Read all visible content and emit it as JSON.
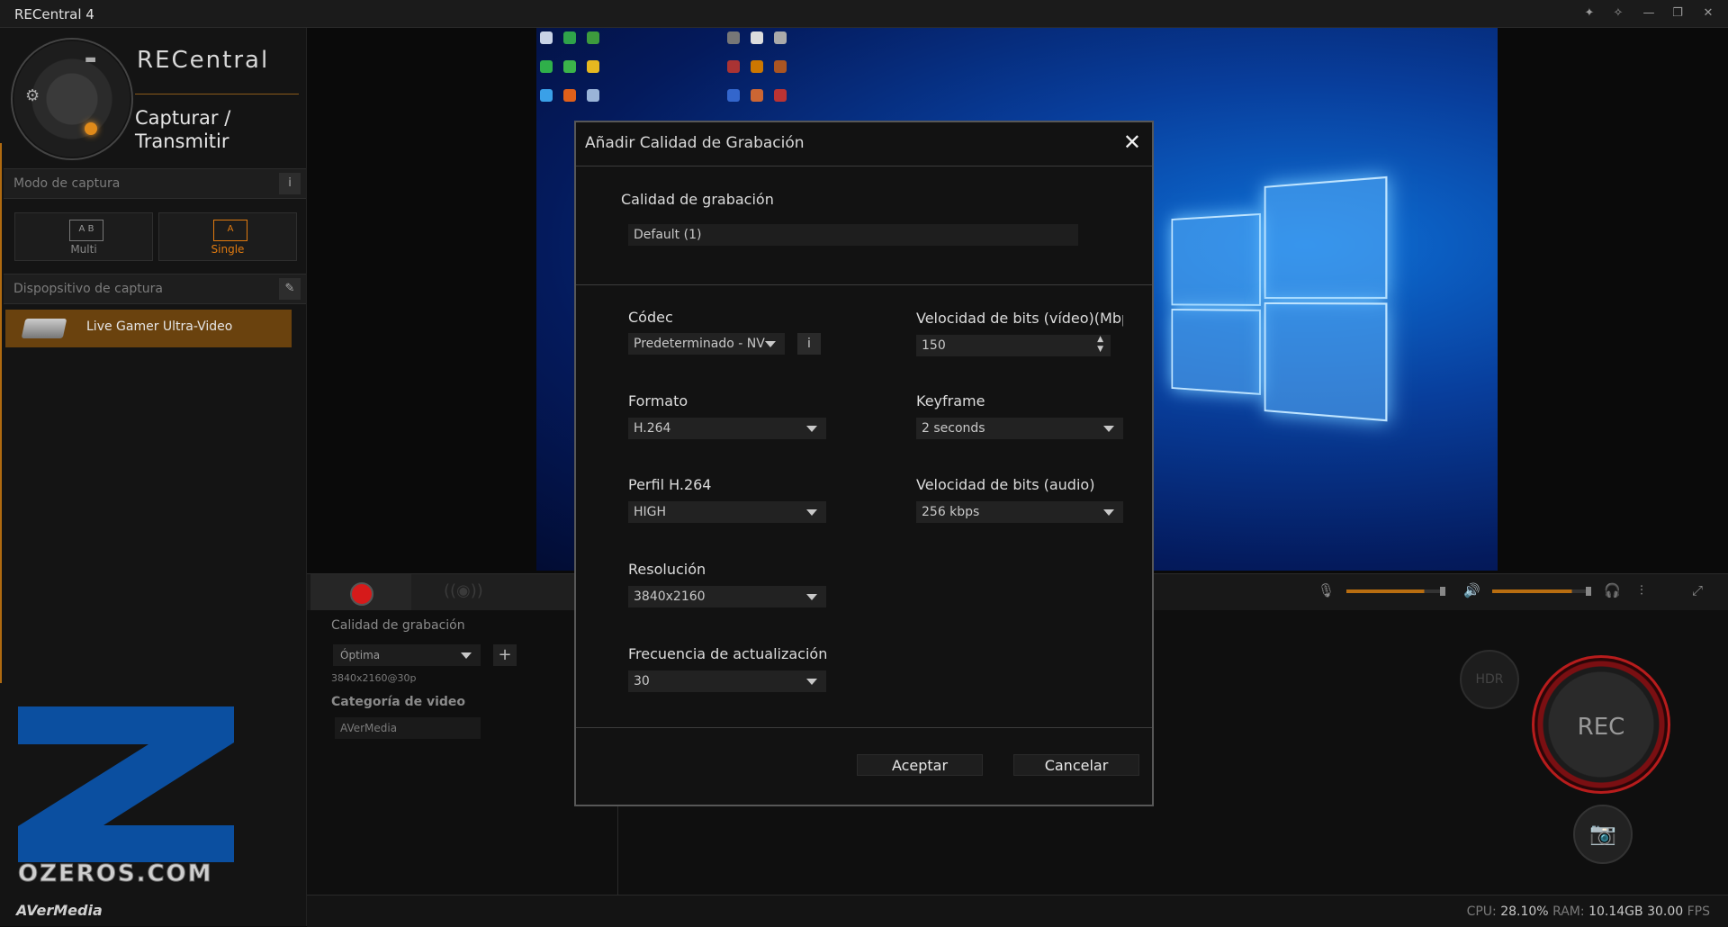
{
  "window": {
    "title": "RECentral 4",
    "controls": [
      "pin-icon",
      "pin-alt-icon",
      "minimize-icon",
      "restore-icon",
      "close-icon"
    ]
  },
  "sidebar": {
    "brand": "RECentral",
    "mode_title": "Capturar / Transmitir",
    "capture_mode": {
      "label": "Modo de captura",
      "info_icon": "i",
      "options": [
        {
          "box": "A  B",
          "label": "Multi"
        },
        {
          "box": "A",
          "label": "Single"
        }
      ]
    },
    "capture_device": {
      "label": "Dispopsitivo de captura",
      "device_name": "Live Gamer Ultra-Video"
    },
    "watermark": "OZEROS.COM",
    "footer_brand": "AVerMedia"
  },
  "controls": {
    "quality_label": "Calidad de grabación",
    "quality_value": "Óptima",
    "quality_add": "+",
    "quality_res": "3840x2160@30p",
    "category_label": "Categoría de video",
    "category_value": "AVerMedia",
    "hdr_label": "HDR",
    "rec_label": "REC",
    "mic_level": 0.8,
    "volume_level": 0.82
  },
  "status": {
    "cpu_label": "CPU:",
    "cpu_value": "28.10%",
    "ram_label": "RAM:",
    "ram_value": "10.14GB",
    "fps_value": "30.00",
    "fps_label": "FPS"
  },
  "dialog": {
    "title": "Añadir Calidad de Grabación",
    "close": "✕",
    "name_label": "Calidad de grabación",
    "name_value": "Default (1)",
    "codec_label": "Códec",
    "codec_value": "Predeterminado - NV",
    "codec_info": "i",
    "format_label": "Formato",
    "format_value": "H.264",
    "profile_label": "Perfil H.264",
    "profile_value": "HIGH",
    "resolution_label": "Resolución",
    "resolution_value": "3840x2160",
    "framerate_label": "Frecuencia de actualización",
    "framerate_value": "30",
    "video_bitrate_label": "Velocidad de bits (vídeo)(Mbp",
    "video_bitrate_value": "150",
    "keyframe_label": "Keyframe",
    "keyframe_value": "2 seconds",
    "audio_bitrate_label": "Velocidad de bits (audio)",
    "audio_bitrate_value": "256 kbps",
    "accept": "Aceptar",
    "cancel": "Cancelar"
  }
}
